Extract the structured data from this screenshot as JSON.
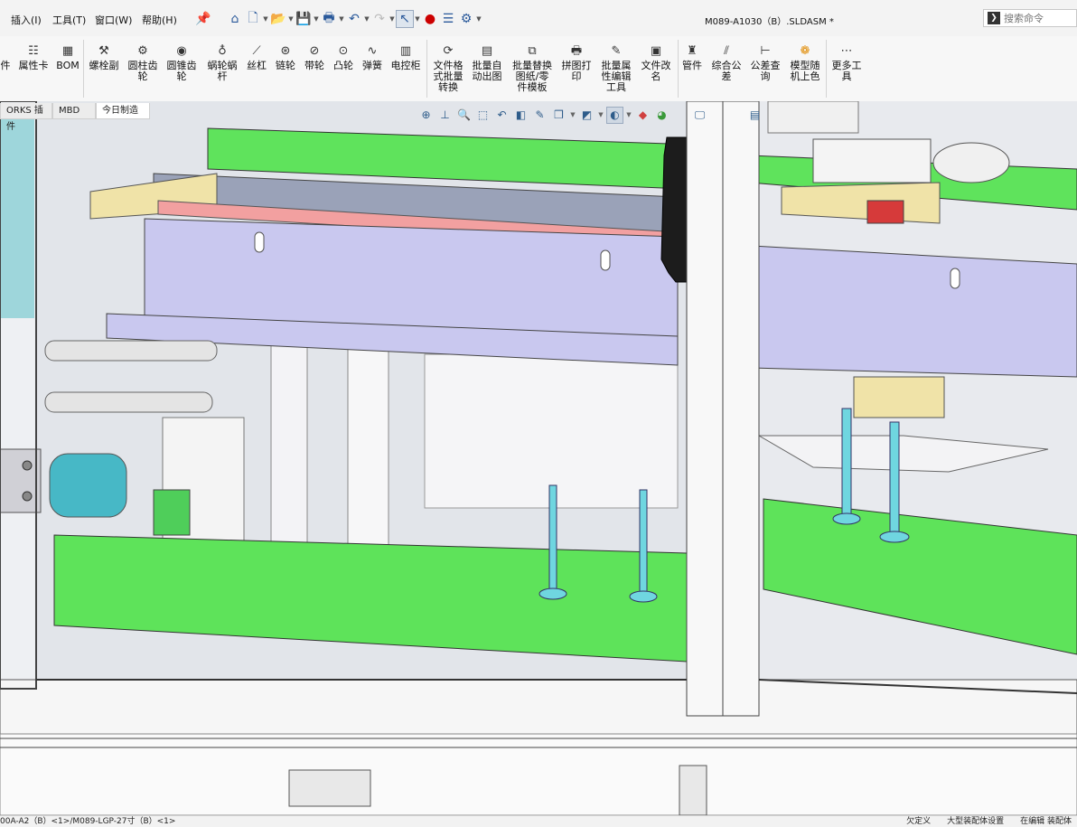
{
  "menu": {
    "items": [
      "插入(I)",
      "工具(T)",
      "窗口(W)",
      "帮助(H)"
    ]
  },
  "title": {
    "document": "M089-A1030（B）.SLDASM *"
  },
  "search": {
    "placeholder": "搜索命令"
  },
  "ribbon": {
    "items": [
      {
        "label": "件",
        "icon": "part-icon"
      },
      {
        "label": "属性卡",
        "icon": "property-card-icon"
      },
      {
        "label": "BOM",
        "icon": "bom-icon"
      },
      {
        "label": "螺栓副",
        "icon": "bolt-icon"
      },
      {
        "label": "圆柱齿\n轮",
        "icon": "spur-gear-icon"
      },
      {
        "label": "圆锥齿\n轮",
        "icon": "bevel-gear-icon"
      },
      {
        "label": "蜗轮蜗\n杆",
        "icon": "worm-gear-icon"
      },
      {
        "label": "丝杠",
        "icon": "lead-screw-icon"
      },
      {
        "label": "链轮",
        "icon": "sprocket-icon"
      },
      {
        "label": "带轮",
        "icon": "pulley-icon"
      },
      {
        "label": "凸轮",
        "icon": "cam-icon"
      },
      {
        "label": "弹簧",
        "icon": "spring-icon"
      },
      {
        "label": "电控柜",
        "icon": "cabinet-icon"
      },
      {
        "label": "文件格\n式批量\n转换",
        "icon": "batch-convert-icon"
      },
      {
        "label": "批量自\n动出图",
        "icon": "batch-drawing-icon"
      },
      {
        "label": "批量替换\n图纸/零\n件模板",
        "icon": "batch-replace-icon"
      },
      {
        "label": "拼图打\n印",
        "icon": "print-icon"
      },
      {
        "label": "批量属\n性编辑\n工具",
        "icon": "batch-property-icon"
      },
      {
        "label": "文件改\n名",
        "icon": "rename-icon"
      },
      {
        "label": "管件",
        "icon": "pipe-icon"
      },
      {
        "label": "综合公\n差",
        "icon": "tolerance-icon"
      },
      {
        "label": "公差查\n询",
        "icon": "tolerance-query-icon"
      },
      {
        "label": "模型随\n机上色",
        "icon": "random-color-icon"
      },
      {
        "label": "更多工\n具",
        "icon": "more-tools-icon"
      }
    ]
  },
  "tabs": [
    "ORKS 插件",
    "MBD",
    "今日制造"
  ],
  "status": {
    "left": "00A-A2（B）<1>/M089-LGP-27寸（B）<1>",
    "right": "欠定义　　大型装配体设置　　在编辑 装配体"
  },
  "colors": {
    "green_plate": "#5ee35a",
    "lavender_plate": "#c9c8ef",
    "teal_part": "#6fd6e0"
  }
}
